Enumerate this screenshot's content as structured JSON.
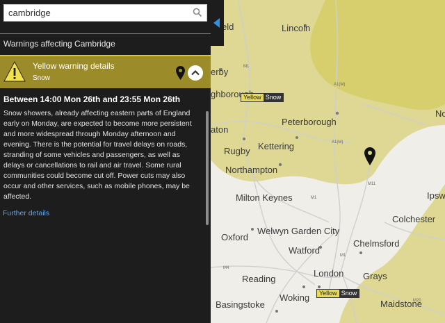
{
  "search": {
    "value": "cambridge"
  },
  "warnings_header": "Warnings affecting Cambridge",
  "warning": {
    "title": "Yellow warning details",
    "type": "Snow",
    "color": "#9c8b29",
    "period": "Between 14:00 Mon 26th and 23:55 Mon 26th",
    "description": "Snow showers, already affecting eastern parts of England early on Monday, are expected to become more persistent and more widespread through Monday afternoon and evening. There is the potential for travel delays on roads, stranding of some vehicles and passengers, as well as delays or cancellations to rail and air travel. Some rural communities could become cut off. Power cuts may also occur and other services, such as mobile phones, may be affected.",
    "link": "Further details"
  },
  "icons": [
    "search-icon",
    "warning-triangle-icon",
    "location-pin-icon",
    "chevron-up-icon",
    "panel-toggle-arrow-icon",
    "map-pin-icon"
  ],
  "map": {
    "cities": {
      "lincoln": "Lincoln",
      "eld": "eld",
      "derby": "erby",
      "ghborough": "ghborough",
      "peterborough": "Peterborough",
      "aton": "aton",
      "kettering": "Kettering",
      "rugby": "Rugby",
      "northampton": "Northampton",
      "no": "No",
      "milton_keynes": "Milton Keynes",
      "ipsw": "Ipsw",
      "colchester": "Colchester",
      "welwyn": "Welwyn Garden City",
      "oxford": "Oxford",
      "watford": "Watford",
      "chelmsford": "Chelmsford",
      "reading": "Reading",
      "london": "London",
      "grays": "Grays",
      "basingstoke": "Basingstoke",
      "woking": "Woking",
      "maidstone": "Maidstone"
    },
    "roads": {
      "m1_north": "M1",
      "a1m": "A1(M)",
      "a1m_b": "A1(M)",
      "m11": "M11",
      "m1": "M1",
      "m4": "M4",
      "m20": "M20",
      "m1_south": "M1"
    },
    "badges": [
      {
        "level": "Yellow",
        "type": "Snow"
      },
      {
        "level": "Yellow",
        "type": "Snow"
      }
    ],
    "warning_fill": "#dcd68c"
  }
}
